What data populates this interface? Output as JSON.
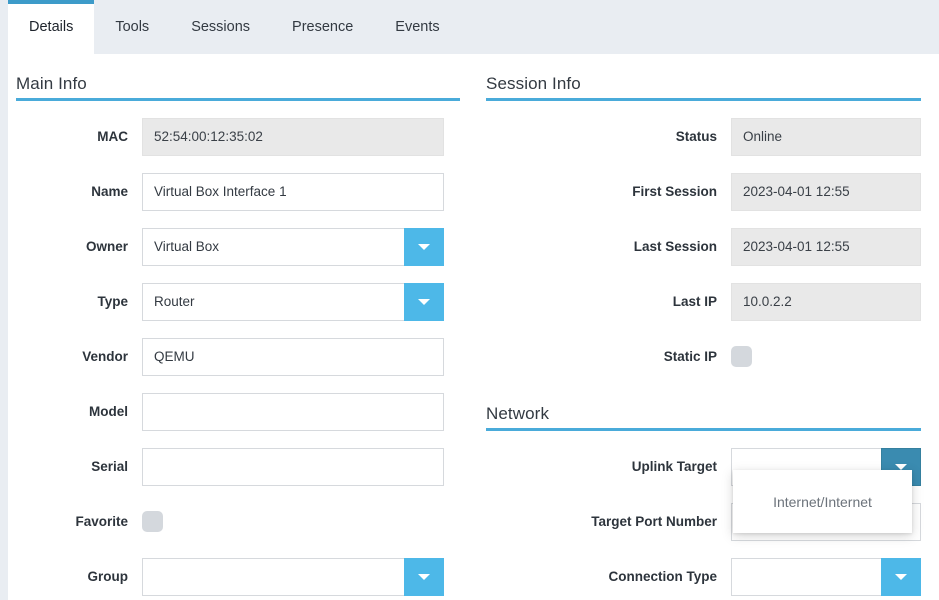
{
  "tabs": [
    {
      "label": "Details",
      "active": true
    },
    {
      "label": "Tools",
      "active": false
    },
    {
      "label": "Sessions",
      "active": false
    },
    {
      "label": "Presence",
      "active": false
    },
    {
      "label": "Events",
      "active": false
    }
  ],
  "colors": {
    "accent_blue": "#4aabda",
    "combo_button": "#4db8e8",
    "combo_button_pressed": "#3a8bb0",
    "tabbar_background": "#e9edf2",
    "readonly_field": "#e9e9e9",
    "checkbox": "#d4d8dd"
  },
  "sections": {
    "main_info": {
      "title": "Main Info",
      "fields": [
        {
          "label": "MAC",
          "value": "52:54:00:12:35:02",
          "kind": "readonly"
        },
        {
          "label": "Name",
          "value": "Virtual Box Interface 1",
          "kind": "text"
        },
        {
          "label": "Owner",
          "value": "Virtual Box",
          "kind": "combo"
        },
        {
          "label": "Type",
          "value": "Router",
          "kind": "combo"
        },
        {
          "label": "Vendor",
          "value": "QEMU",
          "kind": "text"
        },
        {
          "label": "Model",
          "value": "",
          "kind": "text"
        },
        {
          "label": "Serial",
          "value": "",
          "kind": "text"
        },
        {
          "label": "Favorite",
          "value": "",
          "kind": "checkbox",
          "checked": false
        },
        {
          "label": "Group",
          "value": "",
          "kind": "combo"
        }
      ]
    },
    "session_info": {
      "title": "Session Info",
      "fields": [
        {
          "label": "Status",
          "value": "Online",
          "kind": "readonly"
        },
        {
          "label": "First Session",
          "value": "2023-04-01  12:55",
          "kind": "readonly"
        },
        {
          "label": "Last Session",
          "value": "2023-04-01  12:55",
          "kind": "readonly"
        },
        {
          "label": "Last IP",
          "value": "10.0.2.2",
          "kind": "readonly"
        },
        {
          "label": "Static IP",
          "value": "",
          "kind": "checkbox",
          "checked": false
        }
      ]
    },
    "network": {
      "title": "Network",
      "fields": [
        {
          "label": "Uplink Target",
          "value": "",
          "kind": "combo",
          "pressed": true
        },
        {
          "label": "Target Port Number",
          "value": "",
          "kind": "text"
        },
        {
          "label": "Connection Type",
          "value": "",
          "kind": "combo",
          "pressed": false
        }
      ]
    }
  },
  "dropdown_popup": {
    "open": true,
    "owner_field": "Uplink Target",
    "options": [
      "Internet/Internet"
    ],
    "selected_label": "Internet/Internet"
  }
}
